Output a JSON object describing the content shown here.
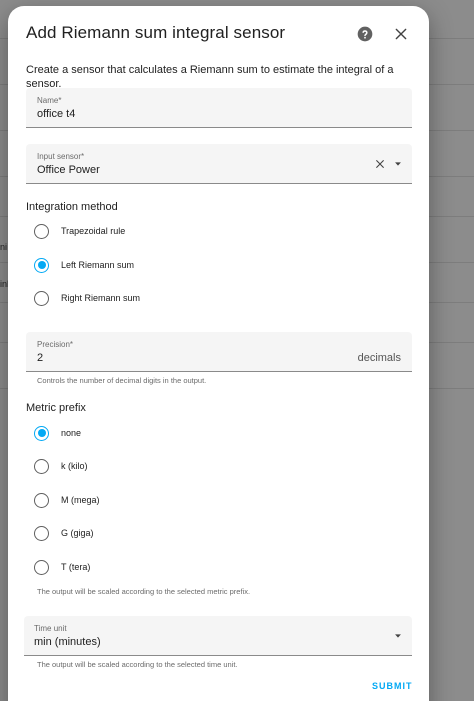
{
  "background": {
    "fragments": [
      "ni",
      "inl"
    ]
  },
  "dialog": {
    "title": "Add Riemann sum integral sensor",
    "help_icon": "help-circle-icon",
    "close_icon": "close-icon",
    "description": "Create a sensor that calculates a Riemann sum to estimate the integral of a sensor.",
    "submit_label": "SUBMIT"
  },
  "fields": {
    "name": {
      "label": "Name*",
      "value": "office t4"
    },
    "input_sensor": {
      "label": "Input sensor*",
      "value": "Office Power"
    },
    "precision": {
      "label": "Precision*",
      "value": "2",
      "suffix": "decimals",
      "helper": "Controls the number of decimal digits in the output."
    },
    "time_unit": {
      "label": "Time unit",
      "value": "min (minutes)",
      "helper": "The output will be scaled according to the selected time unit."
    }
  },
  "integration_method": {
    "label": "Integration method",
    "options": [
      {
        "label": "Trapezoidal rule",
        "checked": false
      },
      {
        "label": "Left Riemann sum",
        "checked": true
      },
      {
        "label": "Right Riemann sum",
        "checked": false
      }
    ]
  },
  "metric_prefix": {
    "label": "Metric prefix",
    "options": [
      {
        "label": "none",
        "checked": true
      },
      {
        "label": "k (kilo)",
        "checked": false
      },
      {
        "label": "M (mega)",
        "checked": false
      },
      {
        "label": "G (giga)",
        "checked": false
      },
      {
        "label": "T (tera)",
        "checked": false
      }
    ],
    "helper": "The output will be scaled according to the selected metric prefix."
  },
  "colors": {
    "accent": "#03a9f4",
    "field_bg": "#f5f5f5",
    "scrim": "#8c8c8c"
  }
}
